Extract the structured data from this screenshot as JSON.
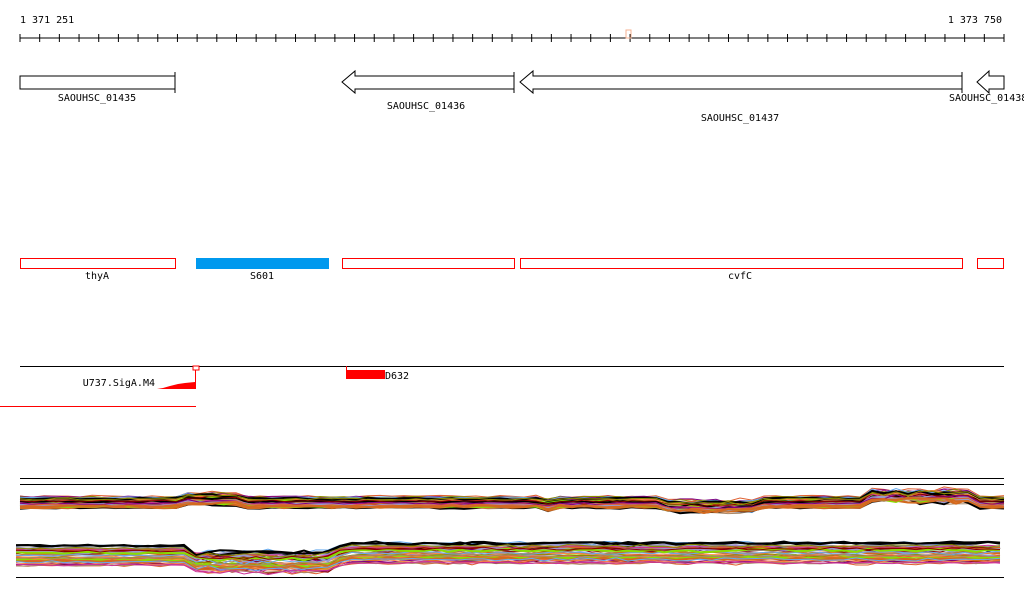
{
  "ruler": {
    "start_label": "1 371 251",
    "end_label": "1 373 750"
  },
  "genes": [
    {
      "name": "SAOUHSC_01435",
      "strand": "+"
    },
    {
      "name": "SAOUHSC_01436",
      "strand": "-"
    },
    {
      "name": "SAOUHSC_01437",
      "strand": "-"
    },
    {
      "name": "SAOUHSC_01438",
      "strand": "-"
    }
  ],
  "features": [
    {
      "name": "thyA",
      "color": "#ff0000",
      "filled": false
    },
    {
      "name": "S601",
      "color": "#0099ee",
      "filled": true
    },
    {
      "name": "",
      "color": "#ff0000",
      "filled": false
    },
    {
      "name": "cvfC",
      "color": "#ff0000",
      "filled": false
    },
    {
      "name": "",
      "color": "#ff0000",
      "filled": false
    }
  ],
  "signals": [
    {
      "name": "U737.SigA.M4",
      "color": "#ff0000"
    },
    {
      "name": "D632",
      "color": "#ff0000"
    }
  ],
  "expression_palette": [
    "#000000",
    "#8b8b00",
    "#e06030",
    "#d2691e",
    "#66aaee",
    "#cc3399",
    "#88dd00",
    "#aa8866",
    "#8b0000",
    "#9999cc",
    "#800080",
    "#ff8844"
  ]
}
